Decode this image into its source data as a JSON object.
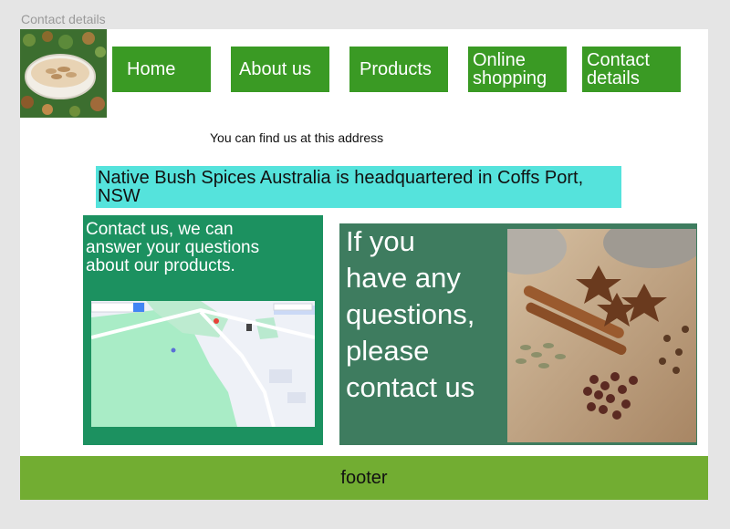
{
  "frame": {
    "title": "Contact details"
  },
  "nav": {
    "home": "Home",
    "about": "About us",
    "products": "Products",
    "online_line1": "Online",
    "online_line2": "shopping",
    "contact_line1": "Contact",
    "contact_line2": "details"
  },
  "main": {
    "intro": "You can find us at this address",
    "address": "Native Bush Spices Australia is headquartered in Coffs Port, NSW",
    "contact_line1": "Contact us, we can",
    "contact_line2": "answer your questions",
    "contact_line3": "about our products.",
    "question_line1": "If you",
    "question_line2": "have any",
    "question_line3": "questions,",
    "question_line4": "please",
    "question_line5": "contact us"
  },
  "footer": {
    "label": "footer"
  },
  "colors": {
    "nav_green": "#3a9a24",
    "address_cyan": "#55e3dc",
    "contact_green": "#1c9160",
    "question_green": "#3e7c5f",
    "footer_green": "#72ad32"
  },
  "icons": {
    "logo": "spice-bowl-logo",
    "map": "map-image",
    "photo": "spices-photo"
  }
}
